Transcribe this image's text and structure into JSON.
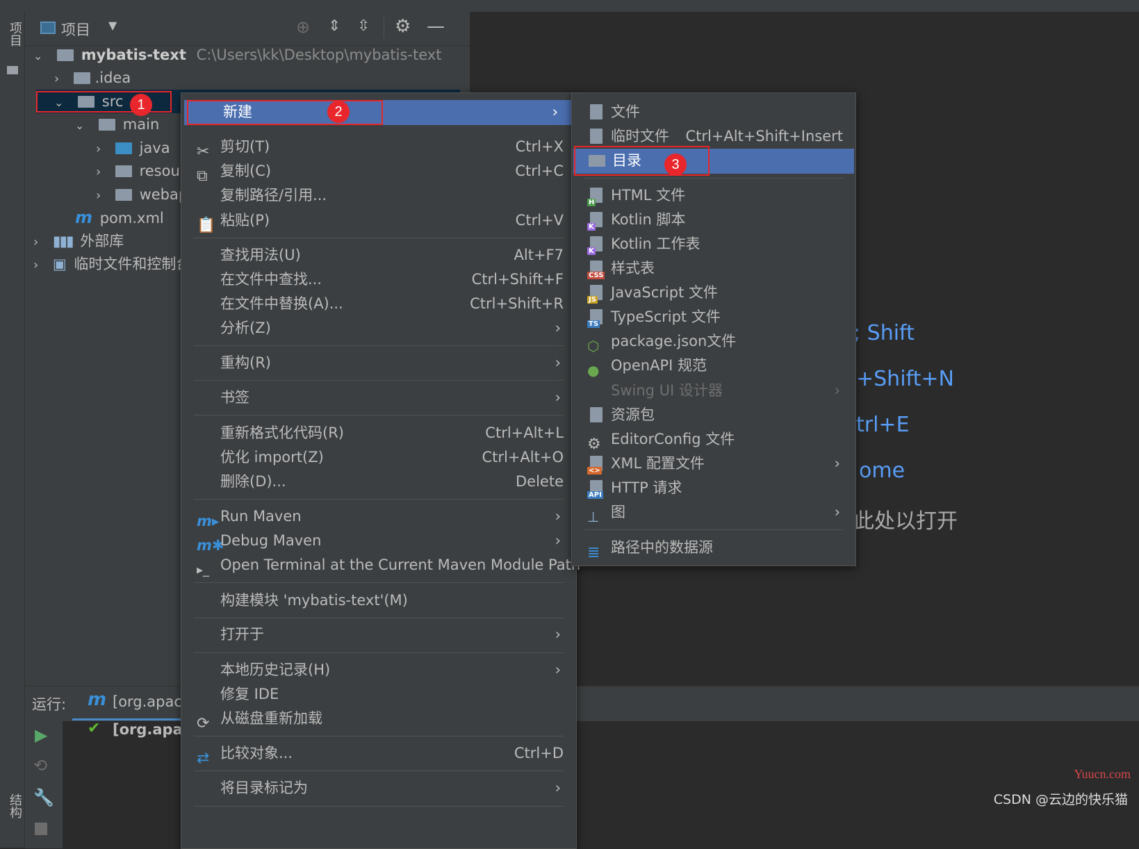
{
  "panel": {
    "title": "项目",
    "side_tab_top": "项目",
    "side_tab_bottom": "结构"
  },
  "tree": {
    "project_name": "mybatis-text",
    "project_path": "C:\\Users\\kk\\Desktop\\mybatis-text",
    "idea": ".idea",
    "src": "src",
    "main": "main",
    "java": "java",
    "resources": "resour",
    "webapp": "webap",
    "pom": "pom.xml",
    "ext_libs": "外部库",
    "scratches": "临时文件和控制台"
  },
  "run": {
    "label": "运行:",
    "config": "[org.apach",
    "item": "[org.apac"
  },
  "context_menu": {
    "new": "新建",
    "cut": "剪切(T)",
    "cut_sc": "Ctrl+X",
    "copy": "复制(C)",
    "copy_sc": "Ctrl+C",
    "copy_path": "复制路径/引用...",
    "paste": "粘贴(P)",
    "paste_sc": "Ctrl+V",
    "find_usages": "查找用法(U)",
    "find_usages_sc": "Alt+F7",
    "find_in_files": "在文件中查找...",
    "find_in_files_sc": "Ctrl+Shift+F",
    "replace_in_files": "在文件中替换(A)...",
    "replace_in_files_sc": "Ctrl+Shift+R",
    "analyze": "分析(Z)",
    "refactor": "重构(R)",
    "bookmarks": "书签",
    "reformat": "重新格式化代码(R)",
    "reformat_sc": "Ctrl+Alt+L",
    "optimize_imports": "优化 import(Z)",
    "optimize_imports_sc": "Ctrl+Alt+O",
    "delete": "删除(D)...",
    "delete_sc": "Delete",
    "run_maven": "Run Maven",
    "debug_maven": "Debug Maven",
    "open_terminal": "Open Terminal at the Current Maven Module Path",
    "build_module": "构建模块 'mybatis-text'(M)",
    "open_in": "打开于",
    "local_history": "本地历史记录(H)",
    "repair_ide": "修复 IDE",
    "reload": "从磁盘重新加载",
    "compare": "比较对象...",
    "compare_sc": "Ctrl+D",
    "mark_dir": "将目录标记为"
  },
  "submenu": {
    "file": "文件",
    "scratch": "临时文件",
    "scratch_sc": "Ctrl+Alt+Shift+Insert",
    "directory": "目录",
    "html": "HTML 文件",
    "kotlin_script": "Kotlin 脚本",
    "kotlin_worksheet": "Kotlin 工作表",
    "stylesheet": "样式表",
    "javascript": "JavaScript 文件",
    "typescript": "TypeScript 文件",
    "package_json": "package.json文件",
    "openapi": "OpenAPI 规范",
    "swing": "Swing UI 设计器",
    "resource_bundle": "资源包",
    "editorconfig": "EditorConfig 文件",
    "xml_config": "XML 配置文件",
    "http_request": "HTTP 请求",
    "diagram": "图",
    "datasource": "路径中的数据源"
  },
  "hints": {
    "h1": "Shift",
    "h2": "+Shift+N",
    "h3": "trl+E",
    "h4": "ome",
    "h5": "此处以打开"
  },
  "badges": [
    "1",
    "2",
    "3"
  ],
  "watermark": {
    "site": "Yuucn.com",
    "csdn": "CSDN @云边的快乐猫"
  },
  "colors": {
    "selection": "#4b6eaf",
    "highlight_box": "#e8262b",
    "hint_text": "#589df6"
  }
}
